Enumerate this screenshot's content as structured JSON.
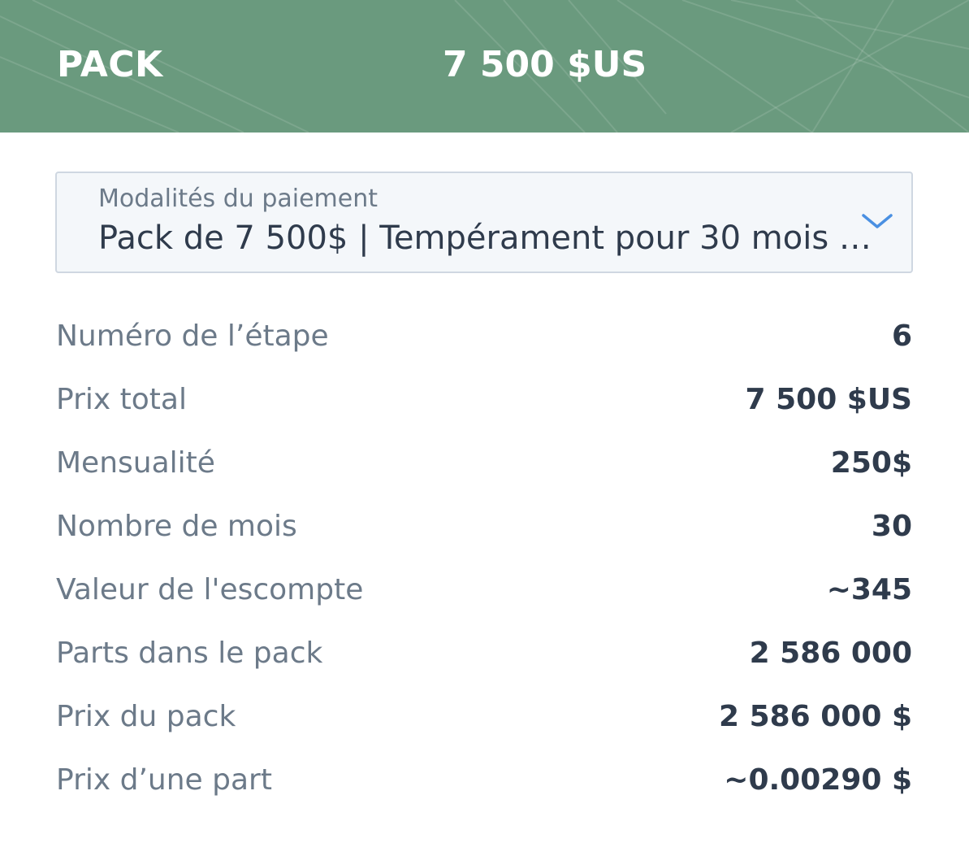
{
  "header": {
    "label": "PACK",
    "price": "7 500 $US",
    "background_color": "#6a9a7e"
  },
  "payment_select": {
    "caption": "Modalités du paiement",
    "value": "Pack de 7 500$ | Tempérament pour 30 mois | ...",
    "icon": "chevron-down-icon",
    "accent_color": "#4a90e2"
  },
  "details": [
    {
      "label": "Numéro de l’étape",
      "value": "6"
    },
    {
      "label": "Prix total",
      "value": "7 500 $US"
    },
    {
      "label": "Mensualité",
      "value": "250$"
    },
    {
      "label": "Nombre de mois",
      "value": "30"
    },
    {
      "label": "Valeur de l'escompte",
      "value": "~345"
    },
    {
      "label": "Parts dans le pack",
      "value": "2 586 000"
    },
    {
      "label": "Prix du pack",
      "value": "2 586 000 $"
    },
    {
      "label": "Prix d’une part",
      "value": "~0.00290 $"
    }
  ]
}
